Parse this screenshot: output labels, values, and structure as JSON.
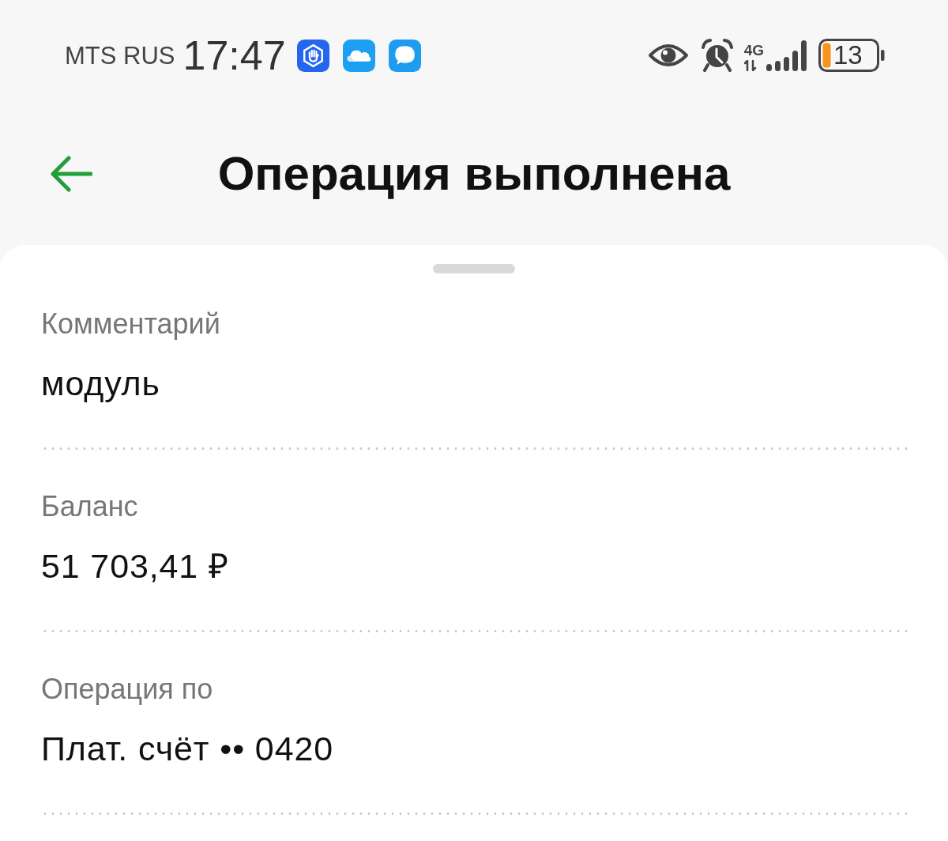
{
  "status_bar": {
    "carrier": "MTS RUS",
    "time": "17:47",
    "network": "4G",
    "battery": "13"
  },
  "header": {
    "title": "Операция выполнена"
  },
  "details": [
    {
      "label": "Комментарий",
      "value": "модуль"
    },
    {
      "label": "Баланс",
      "value": "51 703,41 ₽"
    },
    {
      "label": "Операция по",
      "value": "Плат. счёт •• 0420"
    }
  ]
}
